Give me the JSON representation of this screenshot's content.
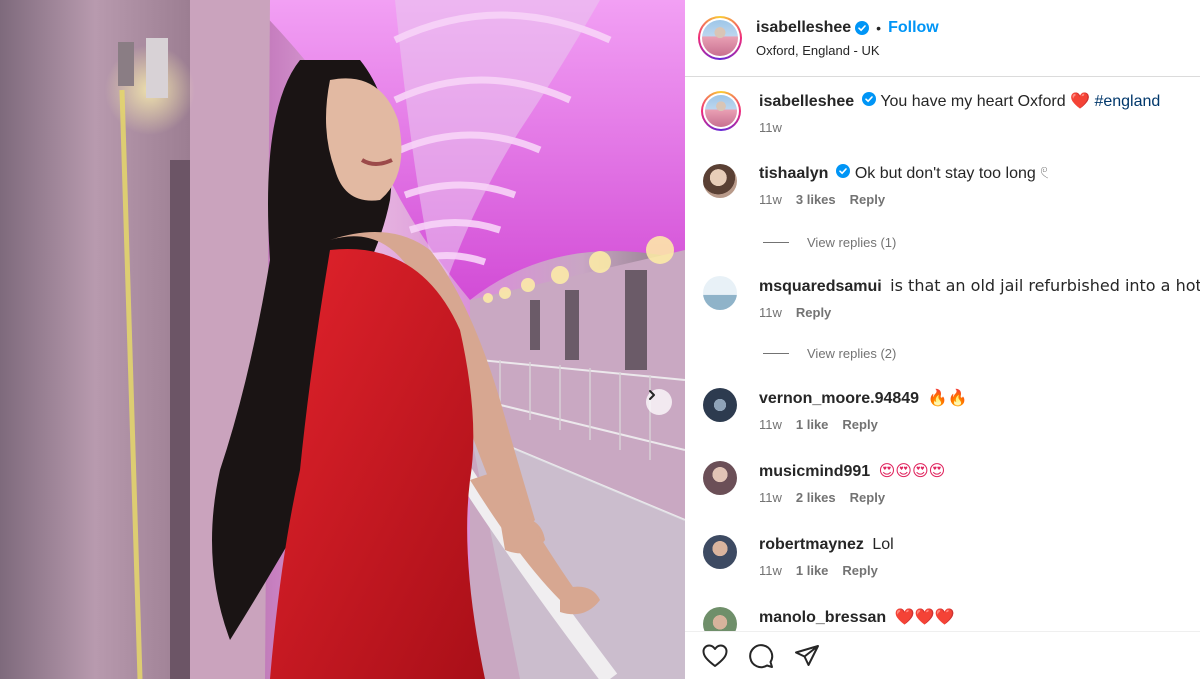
{
  "post": {
    "owner": "isabelleshee",
    "location": "Oxford, England - UK",
    "follow_label": "Follow",
    "separator": "•",
    "caption": {
      "username": "isabelleshee",
      "text": "You have my heart Oxford",
      "emoji": "❤️",
      "hashtag": "#england",
      "time": "11w"
    }
  },
  "comments": [
    {
      "username": "tishaalyn",
      "verified": true,
      "text": "Ok but don't stay too long 𓏲",
      "time": "11w",
      "likes": "3 likes",
      "reply": "Reply",
      "view_replies": "View replies (1)",
      "avatar_color": "#b89a8a"
    },
    {
      "username": "msquaredsamui",
      "verified": false,
      "text": "is that an old jail refurbished into a hotel? 🤓",
      "time": "11w",
      "likes": "",
      "reply": "Reply",
      "view_replies": "View replies (2)",
      "avatar_color": "#cfe3ef"
    },
    {
      "username": "vernon_moore.94849",
      "verified": false,
      "text": "🔥🔥",
      "time": "11w",
      "likes": "1 like",
      "reply": "Reply",
      "view_replies": "",
      "avatar_color": "#2d3b4f"
    },
    {
      "username": "musicmind991",
      "verified": false,
      "text": "😍😍😍😍",
      "time": "11w",
      "likes": "2 likes",
      "reply": "Reply",
      "view_replies": "",
      "avatar_color": "#6b4f57"
    },
    {
      "username": "robertmaynez",
      "verified": false,
      "text": "Lol",
      "time": "11w",
      "likes": "1 like",
      "reply": "Reply",
      "view_replies": "",
      "avatar_color": "#3d4a62"
    },
    {
      "username": "manolo_bressan",
      "verified": false,
      "text": "❤️❤️❤️",
      "time": "",
      "likes": "",
      "reply": "",
      "view_replies": "",
      "avatar_color": "#6f8f6a"
    }
  ],
  "icons": {
    "like": "heart-icon",
    "comment": "comment-icon",
    "share": "share-icon",
    "carousel": "chevron-right-icon",
    "verified": "verified-badge-icon"
  },
  "colors": {
    "accent": "#0095f6",
    "verified": "#0095f6",
    "hashtag": "#00376b",
    "heart": "#ed1c24",
    "meta_text": "#737373"
  }
}
